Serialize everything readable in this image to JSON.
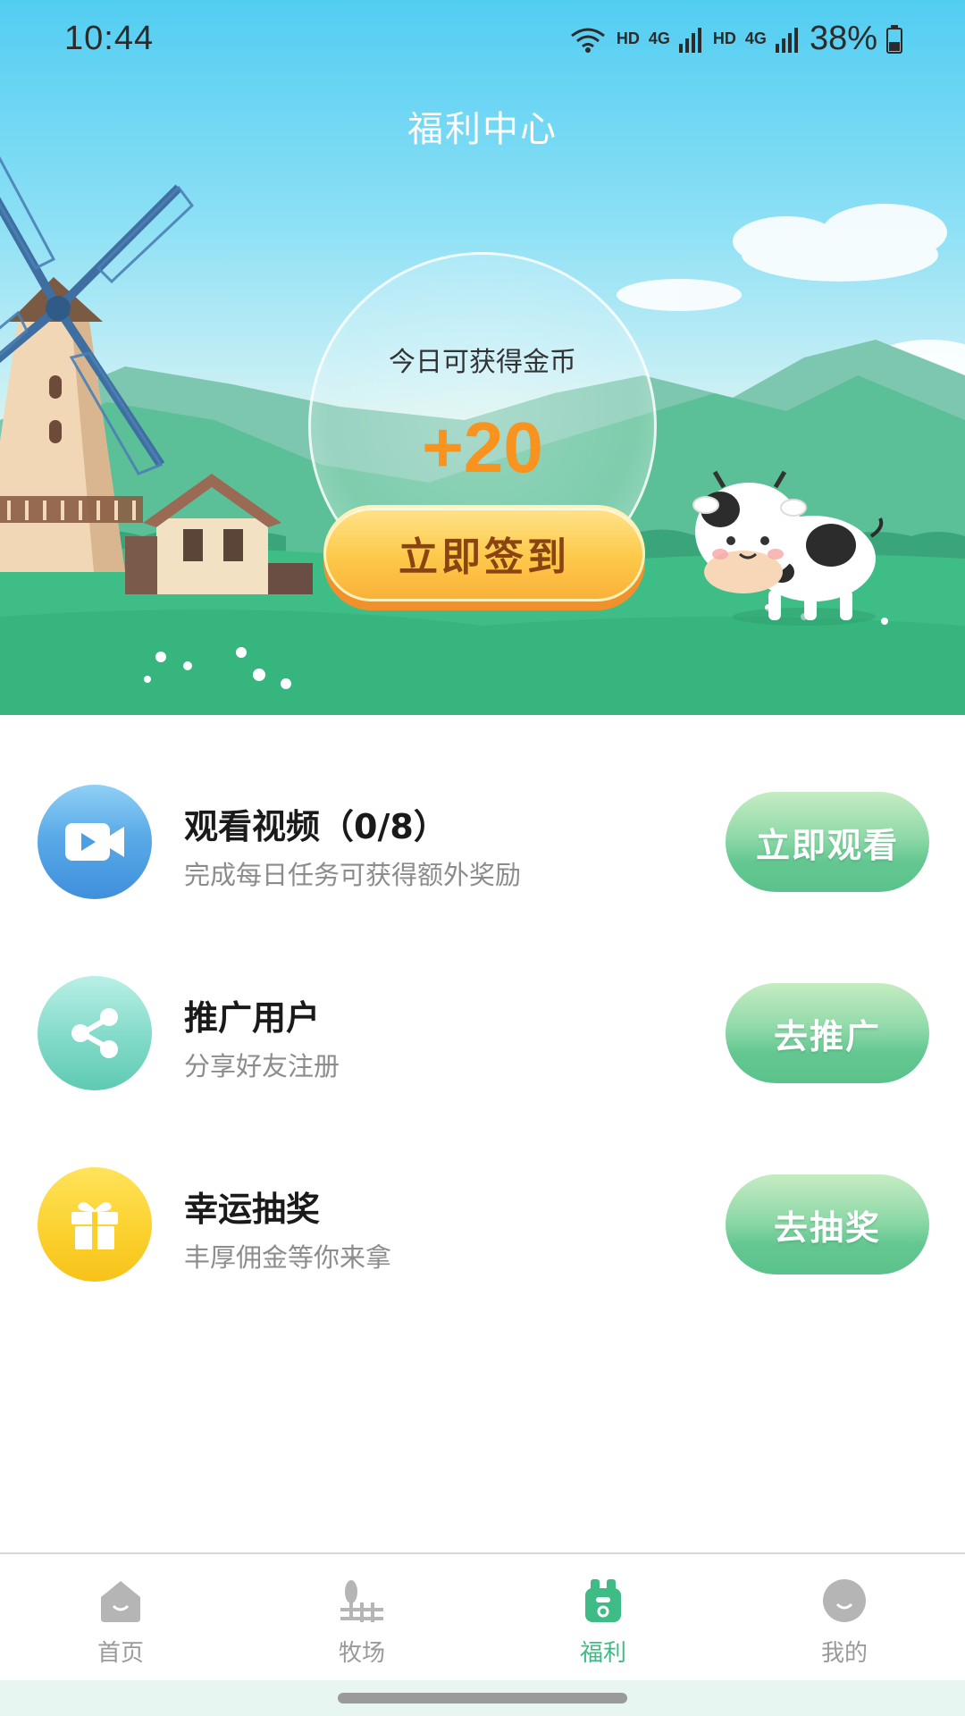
{
  "status_bar": {
    "time": "10:44",
    "hd1": "HD",
    "net1": "4G",
    "hd2": "HD",
    "net2": "4G",
    "battery": "38%"
  },
  "header": {
    "title": "福利中心"
  },
  "checkin": {
    "caption": "今日可获得金币",
    "amount": "+20",
    "button_label": "立即签到"
  },
  "tasks": [
    {
      "title": "观看视频（0/8）",
      "subtitle": "完成每日任务可获得额外奖励",
      "button": "立即观看",
      "icon": "video-camera-icon",
      "icon_color": "#4a9fe6"
    },
    {
      "title": "推广用户",
      "subtitle": "分享好友注册",
      "button": "去推广",
      "icon": "share-icon",
      "icon_color": "#6cd3c0"
    },
    {
      "title": "幸运抽奖",
      "subtitle": "丰厚佣金等你来拿",
      "button": "去抽奖",
      "icon": "gift-icon",
      "icon_color": "#fbd02c"
    }
  ],
  "bottom_nav": [
    {
      "label": "首页",
      "icon": "home-icon",
      "active": false
    },
    {
      "label": "牧场",
      "icon": "ranch-icon",
      "active": false
    },
    {
      "label": "福利",
      "icon": "welfare-icon",
      "active": true
    },
    {
      "label": "我的",
      "icon": "profile-icon",
      "active": false
    }
  ],
  "colors": {
    "accent_green": "#3fbc86",
    "coin_orange": "#f7931e",
    "signin_button": "#fdc94a",
    "task_button": "#64c791"
  }
}
